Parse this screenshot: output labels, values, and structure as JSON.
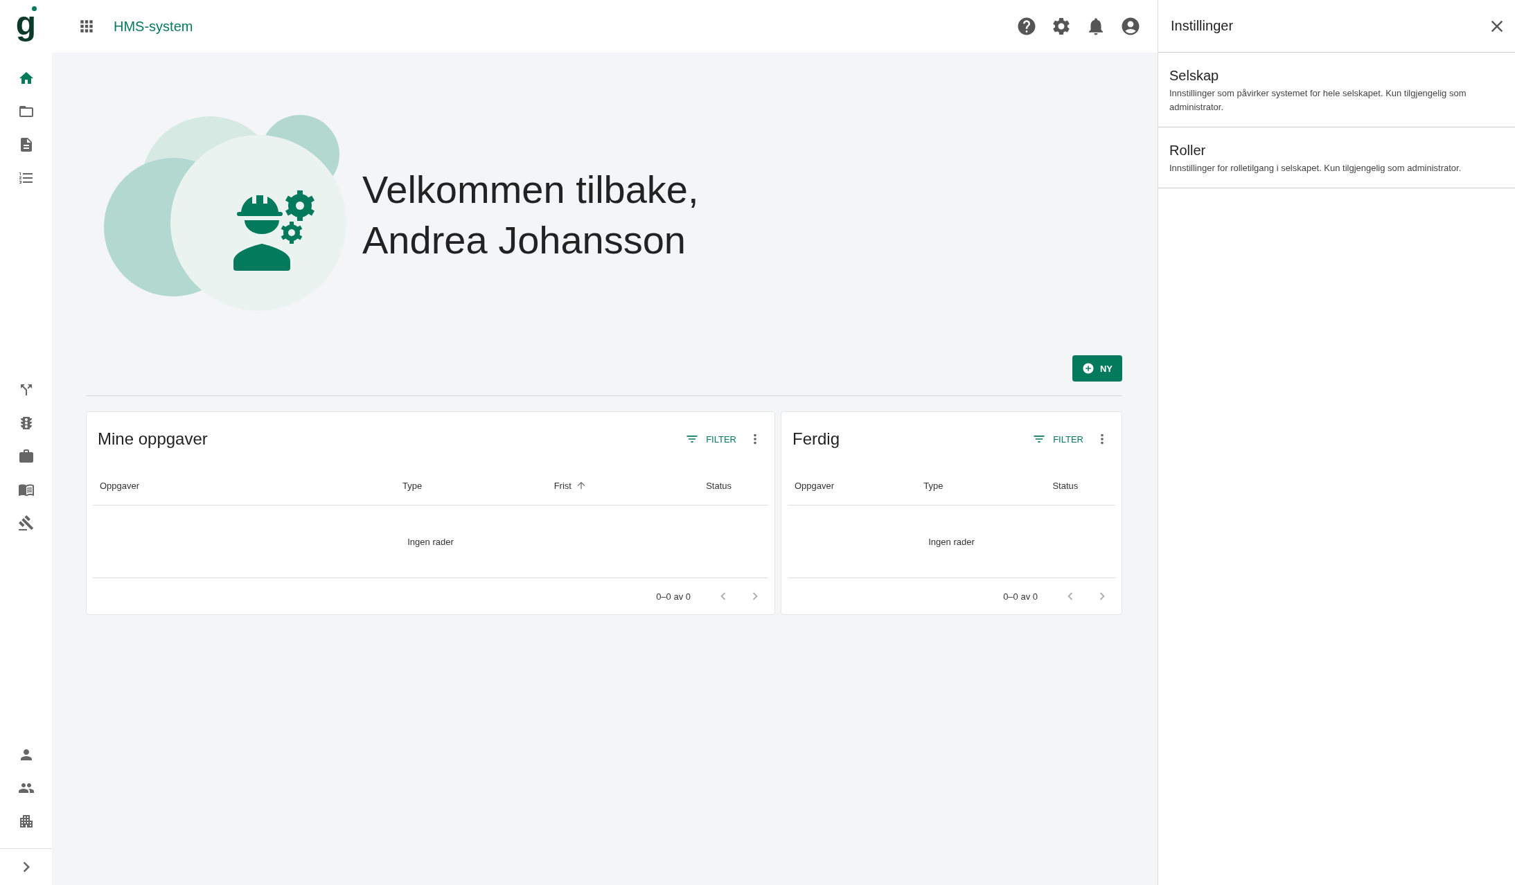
{
  "sidebar": {
    "logo": "g",
    "top_items": [
      {
        "selected": true
      },
      {
        "selected": false
      },
      {
        "selected": false
      },
      {
        "selected": false
      }
    ],
    "middle_items": [
      {
        "selected": false
      },
      {
        "selected": false
      },
      {
        "selected": false
      },
      {
        "selected": false
      },
      {
        "selected": false
      }
    ],
    "bottom_items": [
      {
        "selected": false
      },
      {
        "selected": false
      },
      {
        "selected": false
      }
    ]
  },
  "header": {
    "app_title": "HMS-system"
  },
  "hero": {
    "greeting": "Velkommen tilbake,",
    "name": "Andrea Johansson"
  },
  "new_button": "NY",
  "cards": [
    {
      "title": "Mine oppgaver",
      "filter": "FILTER",
      "columns": [
        {
          "label": "Oppgaver",
          "sorted": false
        },
        {
          "label": "Type",
          "sorted": false
        },
        {
          "label": "Frist",
          "sorted": true
        },
        {
          "label": "Status",
          "sorted": false
        }
      ],
      "empty": "Ingen rader",
      "pagination": "0–0 av 0"
    },
    {
      "title": "Ferdig",
      "filter": "FILTER",
      "columns": [
        {
          "label": "Oppgaver",
          "sorted": false
        },
        {
          "label": "Type",
          "sorted": false
        },
        {
          "label": "Status",
          "sorted": false
        }
      ],
      "empty": "Ingen rader",
      "pagination": "0–0 av 0"
    }
  ],
  "settings_panel": {
    "title": "Instillinger",
    "items": [
      {
        "title": "Selskap",
        "description": "Innstillinger som påvirker systemet for hele selskapet. Kun tilgjengelig som administrator."
      },
      {
        "title": "Roller",
        "description": "Innstillinger for rolletilgang i selskapet. Kun tilgjengelig som administrator."
      }
    ]
  }
}
